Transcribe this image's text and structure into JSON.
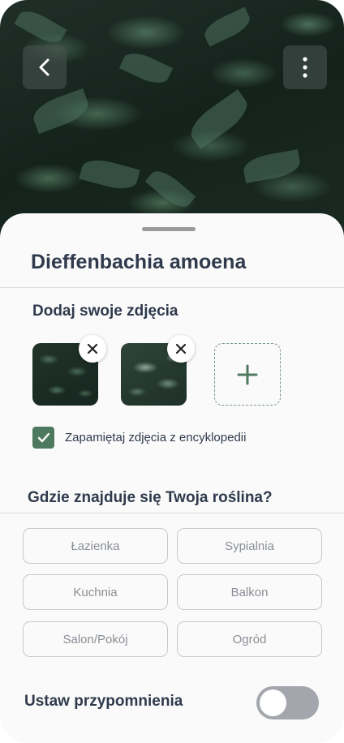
{
  "plant": {
    "name": "Dieffenbachia amoena"
  },
  "photos_section": {
    "title": "Dodaj swoje zdjęcia",
    "remember_label": "Zapamiętaj zdjęcia z encyklopedii",
    "remember_checked": true
  },
  "location_section": {
    "title": "Gdzie znajduje się Twoja roślina?",
    "options": [
      "Łazienka",
      "Sypialnia",
      "Kuchnia",
      "Balkon",
      "Salon/Pokój",
      "Ogród"
    ]
  },
  "reminders": {
    "label": "Ustaw przypomnienia",
    "enabled": false
  },
  "colors": {
    "accent": "#4d7a5e",
    "text": "#2f3a4c",
    "chip_text": "#8a8f96",
    "toggle_off": "#a3a6ac"
  },
  "icons": {
    "back": "chevron-left-icon",
    "more": "more-vertical-icon",
    "remove": "close-icon",
    "add": "plus-icon",
    "check": "check-icon"
  }
}
